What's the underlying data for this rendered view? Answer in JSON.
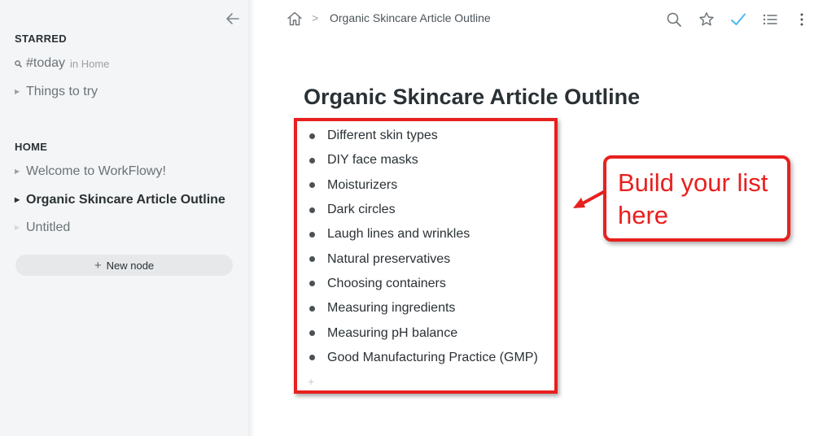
{
  "sidebar": {
    "starred_title": "STARRED",
    "starred": [
      {
        "label": "#today",
        "hint": "in Home"
      },
      {
        "label": "Things to try"
      }
    ],
    "home_title": "HOME",
    "home_items": [
      {
        "label": "Welcome to WorkFlowy!"
      },
      {
        "label": "Organic Skincare Article Outline"
      },
      {
        "label": "Untitled"
      }
    ],
    "new_node_label": "New node"
  },
  "topbar": {
    "breadcrumb": "Organic Skincare Article Outline",
    "icons": [
      "home-icon",
      "search-icon",
      "star-icon",
      "check-icon",
      "list-icon",
      "more-icon"
    ],
    "check_color": "#49baf2"
  },
  "main": {
    "title": "Organic Skincare Article Outline",
    "items": [
      "Different skin types",
      "DIY face masks",
      "Moisturizers",
      "Dark circles",
      "Laugh lines and wrinkles",
      "Natural preservatives",
      "Choosing containers",
      "Measuring ingredients",
      "Measuring pH balance",
      "Good Manufacturing Practice (GMP)"
    ]
  },
  "annotation": {
    "line1": "Build your list",
    "line2": "here",
    "color": "#e8201e"
  }
}
